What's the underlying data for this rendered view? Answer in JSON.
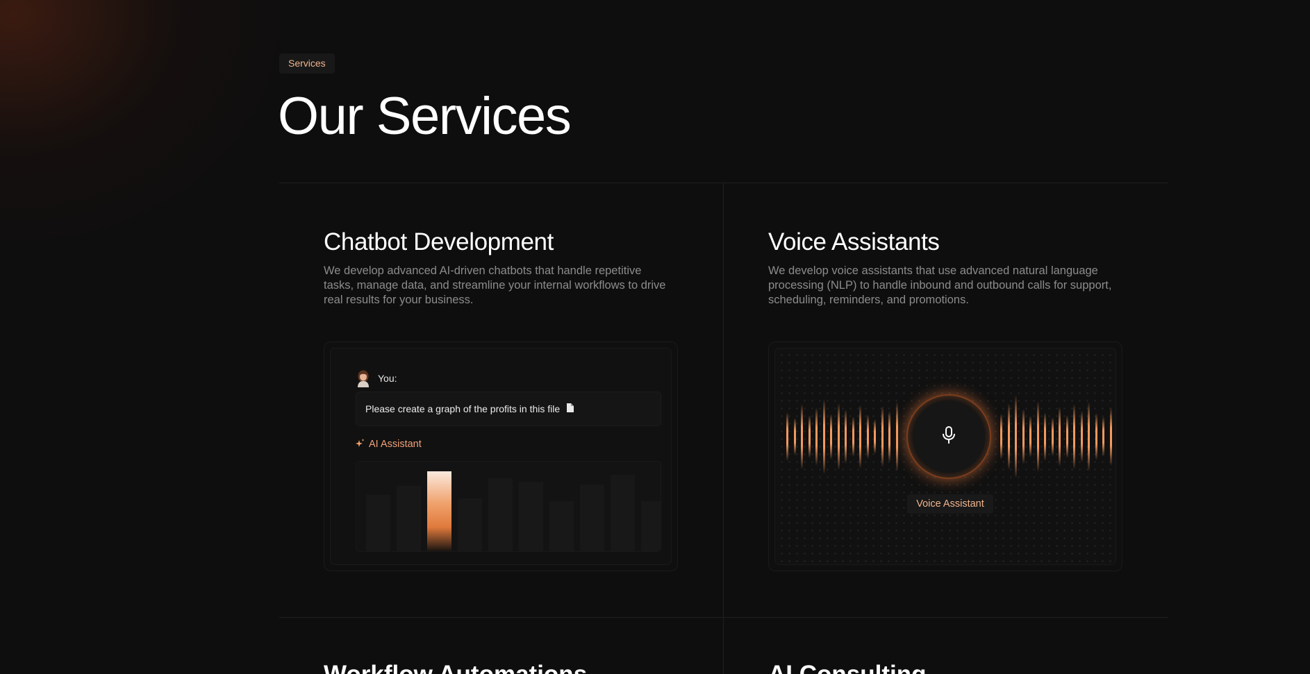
{
  "section": {
    "tag": "Services",
    "title": "Our Services"
  },
  "cards": [
    {
      "title": "Chatbot Development",
      "description": "We develop advanced AI-driven chatbots that handle repetitive tasks, manage data, and streamline your internal workflows to drive real results for your business."
    },
    {
      "title": "Voice Assistants",
      "description": "We develop voice assistants that use advanced natural language processing (NLP) to handle inbound and outbound calls for support, scheduling, reminders, and promotions."
    },
    {
      "title": "Workflow Automations"
    },
    {
      "title": "AI Consulting"
    }
  ],
  "chat_demo": {
    "user_label": "You:",
    "prompt": "Please create a graph of the profits in this file",
    "prompt_icon": "file-icon",
    "assistant_label": "AI Assistant",
    "assistant_icon": "sparkle-icon",
    "highlight_bar_index": 2
  },
  "chart_data": {
    "type": "bar",
    "values": [
      62,
      72,
      88,
      58,
      80,
      76,
      55,
      73,
      84,
      55
    ],
    "highlight_index": 2,
    "highlight_color": "#f0a26d",
    "bar_color": "#181818",
    "xlabel": "",
    "ylabel": ""
  },
  "voice_demo": {
    "label": "Voice Assistant",
    "mic_icon": "microphone-icon",
    "wave_color": "#f59a5e"
  },
  "colors": {
    "background": "#0e0e0e",
    "accent": "#f1b58e",
    "accent_strong": "#f0a26d",
    "muted_text": "#8c8c8c"
  }
}
